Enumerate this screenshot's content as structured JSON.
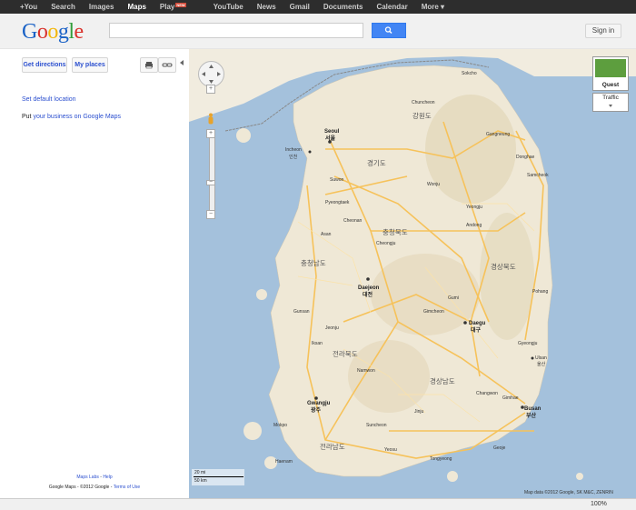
{
  "topnav": {
    "items": [
      "+You",
      "Search",
      "Images",
      "Maps",
      "Play",
      "YouTube",
      "News",
      "Gmail",
      "Documents",
      "Calendar",
      "More ▾"
    ],
    "active": "Maps",
    "play_badge": "NEW"
  },
  "header": {
    "logo_letters": [
      "G",
      "o",
      "o",
      "g",
      "l",
      "e"
    ],
    "search_value": "",
    "signin_label": "Sign in"
  },
  "left_panel": {
    "get_directions": "Get directions",
    "my_places": "My places",
    "set_default_location": "Set default location",
    "put_prefix": "Put",
    "business_link": "your business on Google Maps",
    "footer_labs": "Maps Labs",
    "footer_help": "Help",
    "footer_sep": " - ",
    "footer_copyright": "Google Maps - ©2012 Google",
    "footer_terms": "Terms of Use"
  },
  "map": {
    "quest_label": "Quest",
    "traffic_label": "Traffic",
    "scale_top": "20 mi",
    "scale_bottom": "50 km",
    "map_data": "Map data ©2012 Google, SK M&C, ZENRIN",
    "provinces": [
      {
        "name": "강원도"
      },
      {
        "name": "경기도"
      },
      {
        "name": "충청북도"
      },
      {
        "name": "충청남도"
      },
      {
        "name": "경상북도"
      },
      {
        "name": "전라북도"
      },
      {
        "name": "경상남도"
      },
      {
        "name": "전라남도"
      }
    ],
    "cities": [
      {
        "name": "Seoul",
        "kr": "서울"
      },
      {
        "name": "Incheon",
        "kr": "인천"
      },
      {
        "name": "Daejeon",
        "kr": "대전"
      },
      {
        "name": "Daegu",
        "kr": "대구"
      },
      {
        "name": "Gwangju",
        "kr": "광주"
      },
      {
        "name": "Busan",
        "kr": "부산"
      },
      {
        "name": "Ulsan",
        "kr": "울산"
      }
    ],
    "small_places": [
      "Gangneung",
      "Chuncheon",
      "Wonju",
      "Suwon",
      "Cheongju",
      "Andong",
      "Pohang",
      "Jeonju",
      "Gunsan",
      "Mokpo",
      "Suncheon",
      "Jinju",
      "Gyeongju",
      "Changwon",
      "Gimhae",
      "Yeosu",
      "Sokcho",
      "Donghae",
      "Samcheok",
      "Pyeongtaek",
      "Cheonan",
      "Asan",
      "Gimcheon",
      "Gumi",
      "Yeongju",
      "Iksan",
      "Namwon",
      "Tongyeong",
      "Geoje",
      "Haenam"
    ]
  },
  "statusbar": {
    "zoom": "100%"
  },
  "colors": {
    "land": "#efe8d6",
    "sea": "#a4c1dc",
    "highway": "#f6c25a",
    "mountain": "#dccfae"
  }
}
